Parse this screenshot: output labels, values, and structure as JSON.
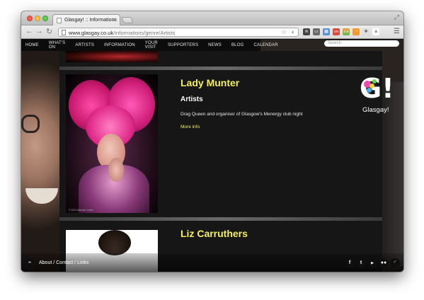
{
  "browser": {
    "tab_title": "Glasgay! :: Informations",
    "url_host": "www.glasgay.co.uk",
    "url_path": "/informations/genre/Artists",
    "extension_badge": "ON",
    "extension_count": "3.9"
  },
  "nav": {
    "items": [
      "HOME",
      "WHAT'S ON",
      "ARTISTS",
      "INFORMATION",
      "YOUR VISIT",
      "SUPPORTERS",
      "NEWS",
      "BLOG",
      "CALENDAR"
    ],
    "search_placeholder": "Search"
  },
  "logo": {
    "mark": "G!",
    "text": "Glasgay!"
  },
  "entries": [
    {
      "title": "Lady Munter",
      "genre": "Artists",
      "description": "Drag Queen and organiser of Glasgow's Menergy club night",
      "more": "More info",
      "credit": "© 2011 Michael Jones"
    },
    {
      "title": "Liz Carruthers"
    }
  ],
  "footer": {
    "links": "About / Contact / Links",
    "social_icons": [
      "facebook-icon",
      "twitter-icon",
      "youtube-icon",
      "flickr-icon",
      "rss-icon"
    ]
  },
  "colors": {
    "accent_yellow": "#f4ef5a",
    "nav_bg": "#0c0c0c",
    "panel_bg": "#161616"
  }
}
